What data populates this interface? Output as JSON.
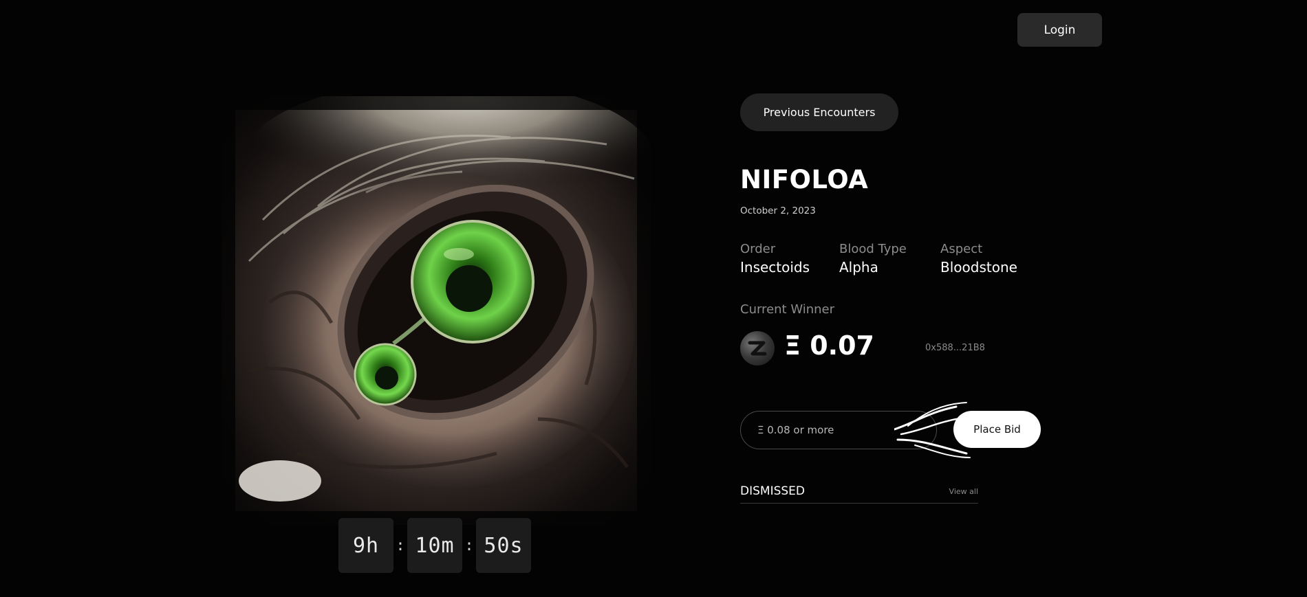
{
  "header": {
    "login_label": "Login"
  },
  "nav": {
    "previous_label": "Previous Encounters"
  },
  "creature": {
    "name": "NIFOLOA",
    "date": "October 2, 2023",
    "attributes": [
      {
        "label": "Order",
        "value": "Insectoids"
      },
      {
        "label": "Blood Type",
        "value": "Alpha"
      },
      {
        "label": "Aspect",
        "value": "Bloodstone"
      }
    ]
  },
  "winner": {
    "label": "Current Winner",
    "amount": "Ξ 0.07",
    "address": "0x588...21B8",
    "avatar_icon": "winner-avatar-icon"
  },
  "bid": {
    "placeholder": "Ξ 0.08 or more",
    "button_label": "Place Bid"
  },
  "dismissed": {
    "title": "DISMISSED",
    "view_all_label": "View all"
  },
  "countdown": {
    "hours": "9h",
    "minutes": "10m",
    "seconds": "50s",
    "separator": ":"
  },
  "colors": {
    "background": "#030303",
    "eye_green": "#3fae22",
    "button_dark": "#2a2a2a",
    "muted_text": "#8c8c8c"
  }
}
